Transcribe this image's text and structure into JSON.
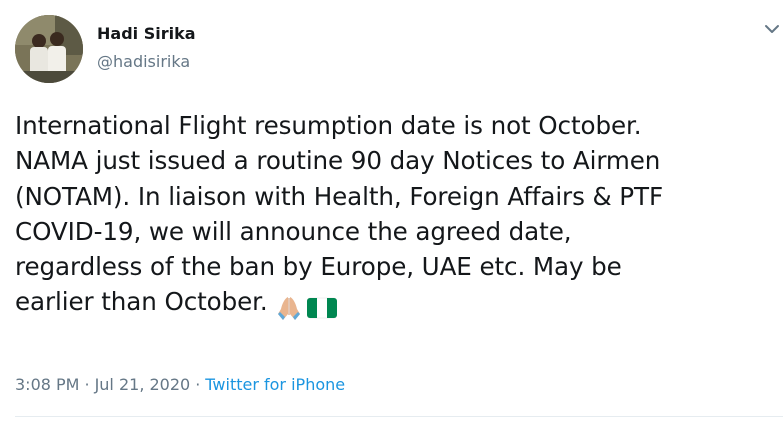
{
  "author": {
    "name": "Hadi Sirika",
    "handle": "@hadisirika"
  },
  "tweet": {
    "text": "International Flight resumption date is not October.\nNAMA just issued a routine 90 day Notices to Airmen\n(NOTAM). In liaison with Health, Foreign Affairs & PTF\nCOVID-19, we will announce the agreed date,\nregardless of the ban by Europe, UAE etc. May be\nearlier than October.",
    "emojis": [
      "folded-hands-emoji",
      "nigeria-flag-emoji"
    ]
  },
  "meta": {
    "time": "3:08 PM",
    "separator": "·",
    "date": "Jul 21, 2020",
    "source": "Twitter for iPhone"
  },
  "colors": {
    "text": "#14171a",
    "secondary": "#657786",
    "link": "#1b95e0",
    "divider": "#e6ecf0",
    "nigeria_green": "#008751"
  }
}
